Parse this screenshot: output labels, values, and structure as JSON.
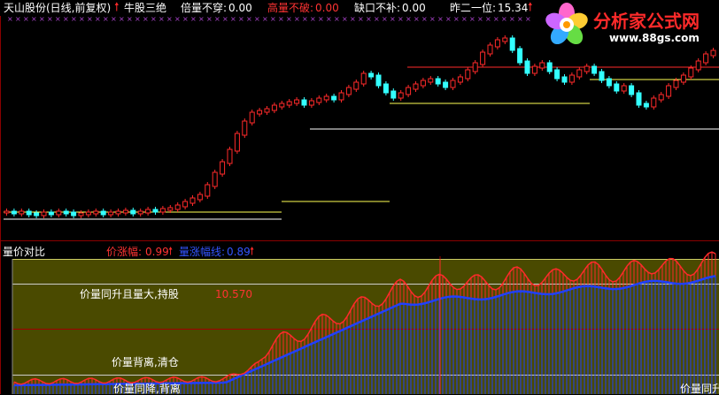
{
  "colors": {
    "bg": "#000000",
    "up": "#ff2a2a",
    "down": "#33ffff",
    "grid": "#8b0000",
    "title": "#ffffff",
    "yellow": "#ffff55",
    "panel": "#4a4a00",
    "blue": "#2040ff"
  },
  "price_panel": {
    "stock_title": "天山股份(日线,前复权)",
    "indicator_name": "牛股三绝",
    "f1_label": "倍量不穿:",
    "f1_value": "0.00",
    "f2_label": "高量不破:",
    "f2_value": "0.00",
    "f3_label": "缺口不补:",
    "f3_value": "0.00",
    "f4_label": "昨二一位:",
    "f4_value": "15.34",
    "mark_gao": "高",
    "mark_bei": "倍",
    "mark_que": "缺"
  },
  "logo": {
    "name": "分析家公式网",
    "url": "www.88gs.com",
    "icon": "flower-icon"
  },
  "volume_panel": {
    "title": "量价对比",
    "series1_label": "价涨幅:",
    "series1_value": "0.99",
    "series2_label": "量涨幅线:",
    "series2_value": "0.89",
    "note_hold": "价量同升且量大,持股",
    "note_value": "10.570",
    "note_clear": "价量背离,清仓",
    "note_bottom_left": "价量同降,背离",
    "note_bottom_right": "价量同升"
  }
}
